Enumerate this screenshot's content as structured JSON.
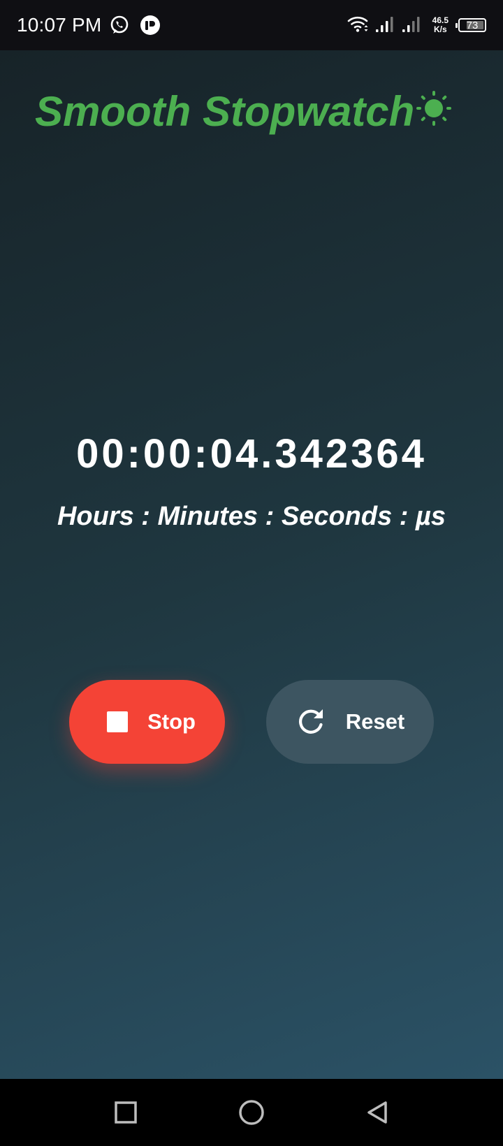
{
  "status_bar": {
    "time": "10:07 PM",
    "net_speed_value": "46.5",
    "net_speed_unit": "K/s",
    "battery_level": "73",
    "battery_fraction": 0.73
  },
  "app": {
    "title": "Smooth Stopwatch",
    "title_color": "#4caf50",
    "theme_icon": "sun-icon"
  },
  "timer": {
    "display": "00:00:04.342364",
    "units_label": "Hours : Minutes : Seconds : µs"
  },
  "controls": {
    "stop_label": "Stop",
    "stop_color": "#f44336",
    "reset_label": "Reset",
    "reset_color": "#3d5561"
  },
  "navigation": {
    "recents_icon": "square-icon",
    "home_icon": "circle-icon",
    "back_icon": "triangle-back-icon"
  }
}
